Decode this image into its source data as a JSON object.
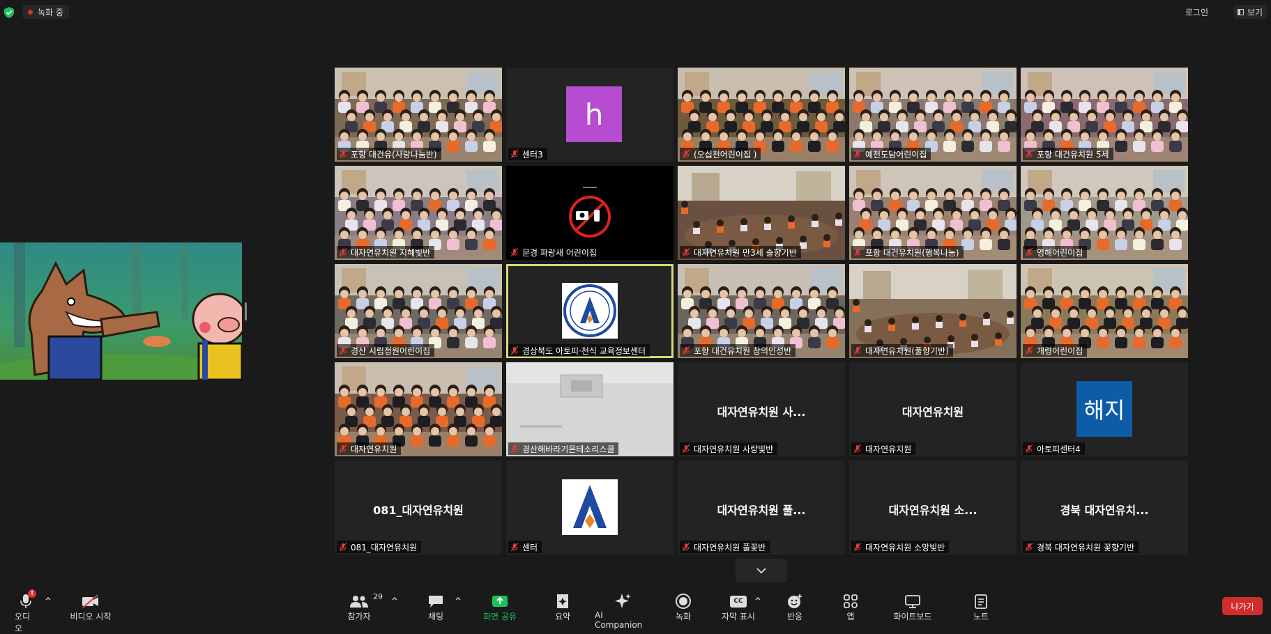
{
  "topbar": {
    "recording_label": "녹화 중",
    "login_label": "로그인",
    "view_label": "보기"
  },
  "tiles": [
    {
      "name": "포항 대건유(사랑나눔반)",
      "type": "video",
      "scene": "classroom",
      "tint": "#7d6a55"
    },
    {
      "name": "센터3",
      "type": "avatar",
      "initial": "h",
      "avatar_color": "#b64cd1"
    },
    {
      "name": "(오십천어린이집 )",
      "type": "video",
      "scene": "orange",
      "tint": "#6e5a3c"
    },
    {
      "name": "예천도담어린이집",
      "type": "video",
      "scene": "classroom",
      "tint": "#8a7a6e"
    },
    {
      "name": "포항 대건유치원 5세",
      "type": "video",
      "scene": "classroom",
      "tint": "#8a6a70"
    },
    {
      "name": "대자연유치원 지혜빛반",
      "type": "video",
      "scene": "classroom",
      "tint": "#8b7d86"
    },
    {
      "name": "문경 파랑새 어린이집",
      "type": "video",
      "scene": "nocamera",
      "tint": "#000000"
    },
    {
      "name": "대자연유치원 만3세 솔향기반",
      "type": "video",
      "scene": "room",
      "tint": "#6a5040"
    },
    {
      "name": "포항 대건유치원(행복나눔)",
      "type": "video",
      "scene": "classroom",
      "tint": "#9a8070"
    },
    {
      "name": "영해어린이집",
      "type": "video",
      "scene": "classroom",
      "tint": "#a0988a"
    },
    {
      "name": "경산 시립정원어린이집",
      "type": "video",
      "scene": "classroom",
      "tint": "#6f6a62"
    },
    {
      "name": "경상북도 아토피·천식 교육정보센터",
      "type": "logo-circle",
      "active": true
    },
    {
      "name": "포항 대건유치원 창의인성반",
      "type": "video",
      "scene": "classroom",
      "tint": "#6c655c"
    },
    {
      "name": "대자연유치원(풀향기반)",
      "type": "video",
      "scene": "room",
      "tint": "#85705a"
    },
    {
      "name": "개령어린이집",
      "type": "video",
      "scene": "orange",
      "tint": "#8a7a5a"
    },
    {
      "name": "대자연유치원",
      "type": "video",
      "scene": "orange",
      "tint": "#7a5a48"
    },
    {
      "name": "경산해바라기몬테소리스쿨",
      "type": "video",
      "scene": "ceiling",
      "tint": "#c8c8c8"
    },
    {
      "name": "대자연유치원 사랑빛반",
      "type": "name",
      "display": "대자연유치원 사..."
    },
    {
      "name": "대자연유치원",
      "type": "name",
      "display": "대자연유치원"
    },
    {
      "name": "아토피센터4",
      "type": "avatar",
      "initial": "해지",
      "avatar_color": "#0e5ca8"
    },
    {
      "name": "081_대자연유치원",
      "type": "name",
      "display": "081_대자연유치원"
    },
    {
      "name": "센터",
      "type": "logo-a"
    },
    {
      "name": "대자연유치원 풀꽃반",
      "type": "name",
      "display": "대자연유치원 풀..."
    },
    {
      "name": "대자연유치원 소망빛반",
      "type": "name",
      "display": "대자연유치원 소..."
    },
    {
      "name": "경북 대자연유치원 꽃향기반",
      "type": "name",
      "display": "경북 대자연유치..."
    }
  ],
  "toolbar": {
    "audio_label": "오디오",
    "audio_badge": "!",
    "video_label": "비디오 시작",
    "participants_label": "참가자",
    "participants_count": "29",
    "chat_label": "채팅",
    "share_label": "화면 공유",
    "summary_label": "요약",
    "ai_label": "AI Companion",
    "record_label": "녹화",
    "captions_label": "자막 표시",
    "captions_icon_text": "CC",
    "reactions_label": "반응",
    "apps_label": "앱",
    "whiteboard_label": "화이트보드",
    "notes_label": "노트",
    "leave_label": "나가기"
  },
  "colors": {
    "background": "#1a1a1a",
    "tile": "#232323",
    "active_border": "#d8d87a",
    "share_green": "#18c45a",
    "leave_red": "#d32c2c",
    "record_dot": "#e02f2f"
  }
}
